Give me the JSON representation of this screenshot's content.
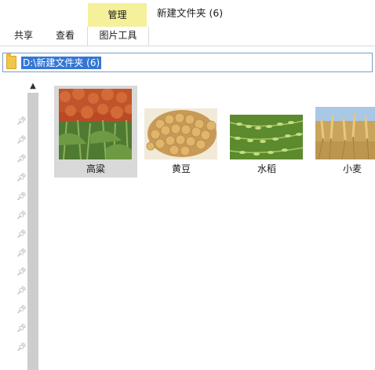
{
  "ribbon": {
    "manage_tab": "管理",
    "window_title": "新建文件夹 (6)",
    "tabs": {
      "share": "共享",
      "view": "查看",
      "picture_tools": "图片工具"
    }
  },
  "address_bar": {
    "path": "D:\\新建文件夹 (6)"
  },
  "files": [
    {
      "name": "高粱",
      "selected": true,
      "icon": "sorghum-thumbnail"
    },
    {
      "name": "黄豆",
      "selected": false,
      "icon": "soybean-thumbnail"
    },
    {
      "name": "水稻",
      "selected": false,
      "icon": "rice-thumbnail"
    },
    {
      "name": "小麦",
      "selected": false,
      "icon": "wheat-thumbnail"
    }
  ],
  "colors": {
    "manage_tab_bg": "#f5f09a",
    "selection_bg": "#d9d9d9",
    "path_highlight": "#3377d6"
  }
}
